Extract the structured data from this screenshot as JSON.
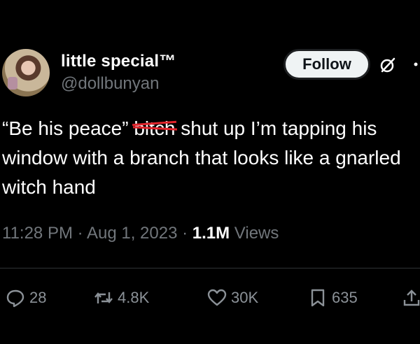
{
  "author": {
    "display_name": "little special™",
    "handle": "@dollbunyan"
  },
  "follow_label": "Follow",
  "tweet": {
    "text_before": "“Be his peace” ",
    "struck_word": "bitch",
    "text_after": " shut up I’m tapping his window with a branch that looks like a gnarled witch hand"
  },
  "meta": {
    "time": "11:28 PM",
    "date": "Aug 1, 2023",
    "views_count": "1.1M",
    "views_label": "Views",
    "separator": " · "
  },
  "actions": {
    "replies": "28",
    "reposts": "4.8K",
    "likes": "30K",
    "bookmarks": "635"
  },
  "icons": [
    "avatar",
    "grok-icon",
    "more-icon",
    "reply-icon",
    "repost-icon",
    "like-icon",
    "bookmark-icon",
    "share-icon"
  ],
  "colors": {
    "background": "#000000",
    "text": "#ffffff",
    "secondary": "#71767b",
    "strike": "#e0242b",
    "button": "#eff3f4"
  }
}
